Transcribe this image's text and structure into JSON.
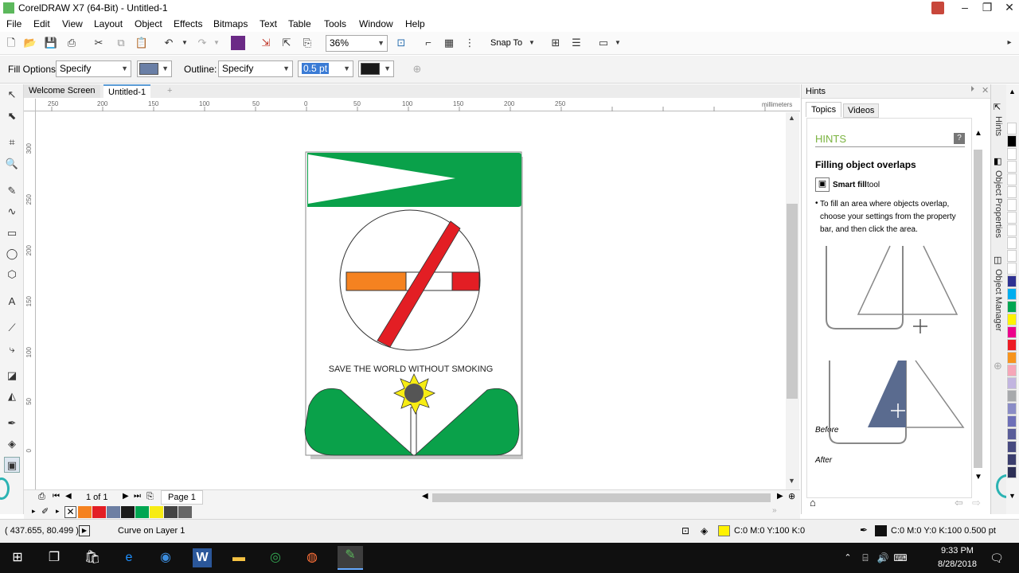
{
  "window": {
    "title": "CorelDRAW X7 (64-Bit) - Untitled-1"
  },
  "menu": [
    "File",
    "Edit",
    "View",
    "Layout",
    "Object",
    "Effects",
    "Bitmaps",
    "Text",
    "Table",
    "Tools",
    "Window",
    "Help"
  ],
  "toolbar": {
    "zoom": "36%",
    "snap_to": "Snap To"
  },
  "property_bar": {
    "fill_options_label": "Fill Options:",
    "fill_options_value": "Specify",
    "outline_label": "Outline:",
    "outline_value": "Specify",
    "outline_width": "0.5 pt",
    "fill_color": "#6a7fa6",
    "outline_color": "#1a1a1a"
  },
  "doc_tabs": [
    "Welcome Screen",
    "Untitled-1"
  ],
  "ruler": {
    "units": "millimeters",
    "h_labels": [
      "250",
      "200",
      "150",
      "100",
      "50",
      "0",
      "50",
      "100",
      "150",
      "200",
      "250"
    ],
    "v_labels": [
      "300",
      "250",
      "200",
      "150",
      "100",
      "50",
      "0"
    ]
  },
  "artwork": {
    "caption": "SAVE THE WORLD WITHOUT SMOKING"
  },
  "page_nav": {
    "count": "1 of 1",
    "page_tab": "Page 1"
  },
  "status": {
    "coords": "( 437.655, 80.499 )",
    "object": "Curve on Layer 1",
    "fill_info": "C:0 M:0 Y:100 K:0",
    "outline_info": "C:0 M:0 Y:0 K:100  0.500 pt"
  },
  "hints": {
    "panel_title": "Hints",
    "tabs": [
      "Topics",
      "Videos"
    ],
    "heading": "HINTS",
    "topic": "Filling object overlaps",
    "tool_bold": "Smart fill",
    "tool_rest": " tool",
    "bullet": "To fill an area where objects overlap, choose your settings from the property bar, and then click the area.",
    "before_label": "Before",
    "after_label": "After"
  },
  "docker_tabs": [
    "Hints",
    "Object Properties",
    "Object Manager"
  ],
  "bottom_palette": [
    "#f58220",
    "#e31e24",
    "#6d7fa3",
    "#1a1a1a",
    "#00a651",
    "#f7ec13",
    "#444444",
    "#666666"
  ],
  "right_palette": [
    "#ffffff",
    "#000000",
    "#ffffff",
    "#ffffff",
    "#ffffff",
    "#ffffff",
    "#ffffff",
    "#ffffff",
    "#ffffff",
    "#ffffff",
    "#ffffff",
    "#ffffff",
    "#2e3192",
    "#00aeef",
    "#00a651",
    "#fff200",
    "#ec008c",
    "#ed1c24",
    "#f7941d",
    "#f6a6b8",
    "#c2b5e0",
    "#a7a9ac",
    "#8a8cc6",
    "#6d6fb8",
    "#5a5d99",
    "#474a80",
    "#3b3e6e",
    "#2d2f56"
  ],
  "taskbar": {
    "time": "9:33 PM",
    "date": "8/28/2018"
  }
}
